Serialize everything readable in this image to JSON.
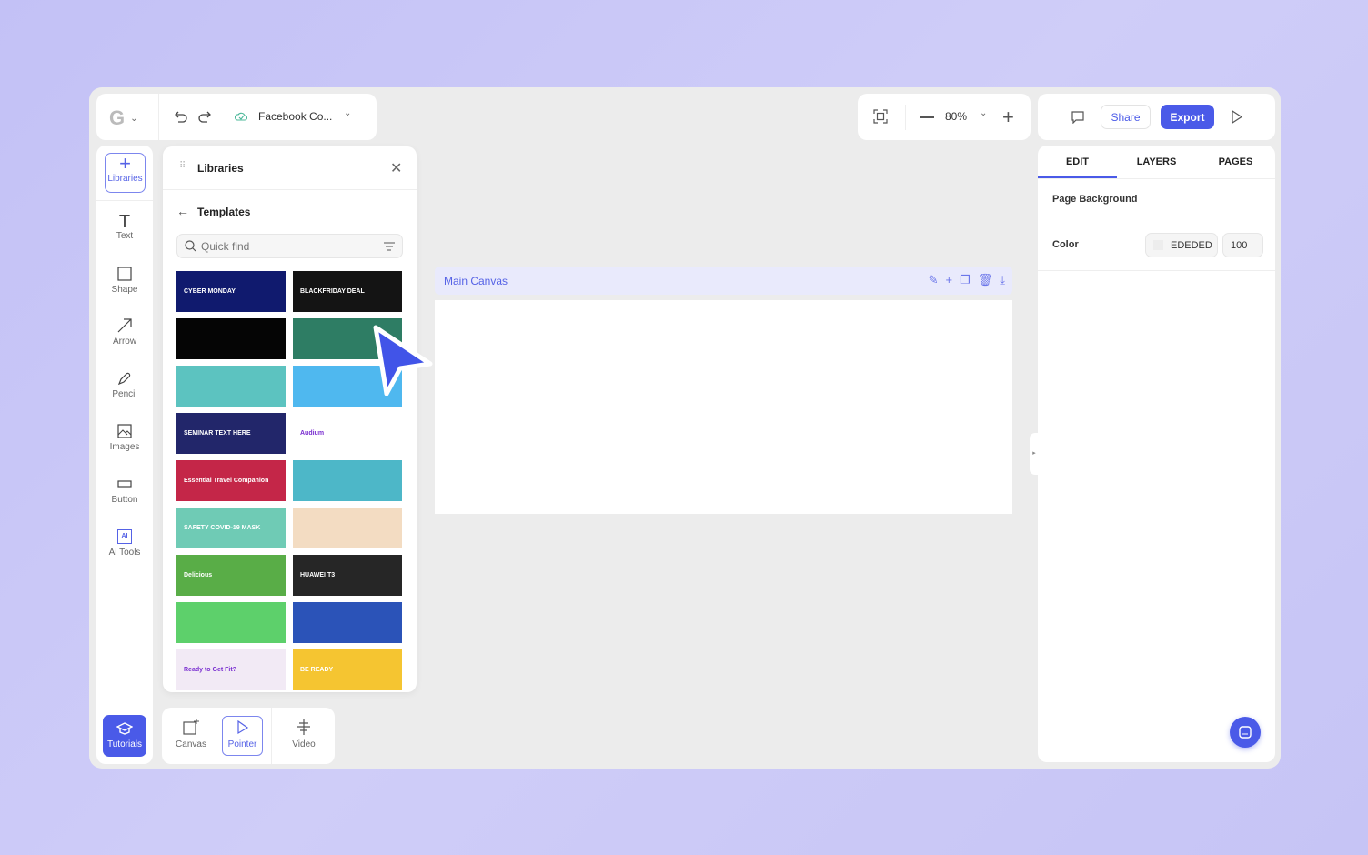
{
  "topbar": {
    "logo": "G",
    "file_name": "Facebook Co...",
    "zoom": "80%"
  },
  "actions": {
    "share": "Share",
    "export": "Export"
  },
  "tools": [
    {
      "label": "Libraries",
      "icon": "plus-icon"
    },
    {
      "label": "Text",
      "icon": "text-icon"
    },
    {
      "label": "Shape",
      "icon": "square-icon"
    },
    {
      "label": "Arrow",
      "icon": "arrow-icon"
    },
    {
      "label": "Pencil",
      "icon": "pencil-icon"
    },
    {
      "label": "Images",
      "icon": "image-icon"
    },
    {
      "label": "Button",
      "icon": "button-icon"
    },
    {
      "label": "Ai Tools",
      "icon": "ai-icon"
    }
  ],
  "libraries": {
    "title": "Libraries",
    "section": "Templates",
    "search_placeholder": "Quick find",
    "templates": [
      {
        "text": "CYBER MONDAY",
        "bg": "#101a6e"
      },
      {
        "text": "BLACKFRIDAY DEAL",
        "bg": "#141414"
      },
      {
        "text": "",
        "bg": "#050505"
      },
      {
        "text": "",
        "bg": "#2e7d64"
      },
      {
        "text": "",
        "bg": "#5cc3c0"
      },
      {
        "text": "",
        "bg": "#4fb8ef"
      },
      {
        "text": "SEMINAR TEXT HERE",
        "bg": "#22266a"
      },
      {
        "text": "Audium",
        "bg": "#ffffff"
      },
      {
        "text": "Essential Travel Companion",
        "bg": "#c42648"
      },
      {
        "text": "",
        "bg": "#4db7c8"
      },
      {
        "text": "SAFETY COVID-19 MASK",
        "bg": "#6fcbb5"
      },
      {
        "text": "",
        "bg": "#f3dcc2"
      },
      {
        "text": "Delicious",
        "bg": "#59ad47"
      },
      {
        "text": "HUAWEI T3",
        "bg": "#262626"
      },
      {
        "text": "",
        "bg": "#5dd06b"
      },
      {
        "text": "",
        "bg": "#2b53b8"
      },
      {
        "text": "Ready to Get Fit?",
        "bg": "#f2eaf5"
      },
      {
        "text": "BE READY",
        "bg": "#f5c531"
      }
    ]
  },
  "bottom": {
    "tutorials": "Tutorials",
    "canvas": "Canvas",
    "pointer": "Pointer",
    "video": "Video"
  },
  "canvas": {
    "title": "Main Canvas"
  },
  "panel": {
    "tabs": [
      "EDIT",
      "LAYERS",
      "PAGES"
    ],
    "active_tab": "EDIT",
    "section": "Page Background",
    "color_label": "Color",
    "color_value": "EDEDED",
    "opacity": "100"
  },
  "colors": {
    "accent": "#4a5ae8",
    "canvas_bg": "#ededed"
  }
}
